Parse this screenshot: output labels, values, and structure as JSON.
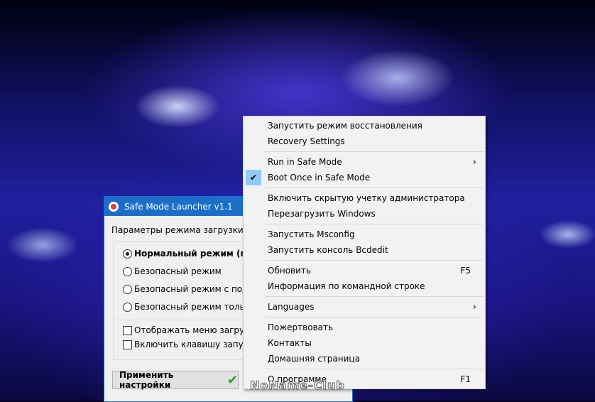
{
  "window": {
    "title": "Safe Mode Launcher v1.1",
    "params_label": "Параметры режима загрузки Win",
    "options": [
      {
        "label": "Нормальный режим (по",
        "selected": true
      },
      {
        "label": "Безопасный режим",
        "selected": false
      },
      {
        "label": "Безопасный режим с подде",
        "selected": false
      },
      {
        "label": "Безопасный режим только",
        "selected": false
      }
    ],
    "checkboxes": [
      {
        "label": "Отображать меню загрузки",
        "checked": false
      },
      {
        "label": "Включить клавишу запуска",
        "checked": false
      }
    ],
    "apply_label": "Применить настройки"
  },
  "menu": {
    "items": [
      "Запустить режим восстановления",
      "Recovery Settings",
      "Run in Safe Mode",
      "Boot Once in Safe Mode",
      "Включить скрытую учетку администратора",
      "Перезагрузить Windows",
      "Запустить Msconfig",
      "Запустить консоль Bcdedit",
      "Обновить",
      "Информация по командной строке",
      "Languages",
      "Пожертвовать",
      "Контакты",
      "Домашняя страница",
      "О программе"
    ],
    "shortcuts": {
      "refresh": "F5",
      "about": "F1"
    }
  },
  "watermark": "NoName-Club"
}
